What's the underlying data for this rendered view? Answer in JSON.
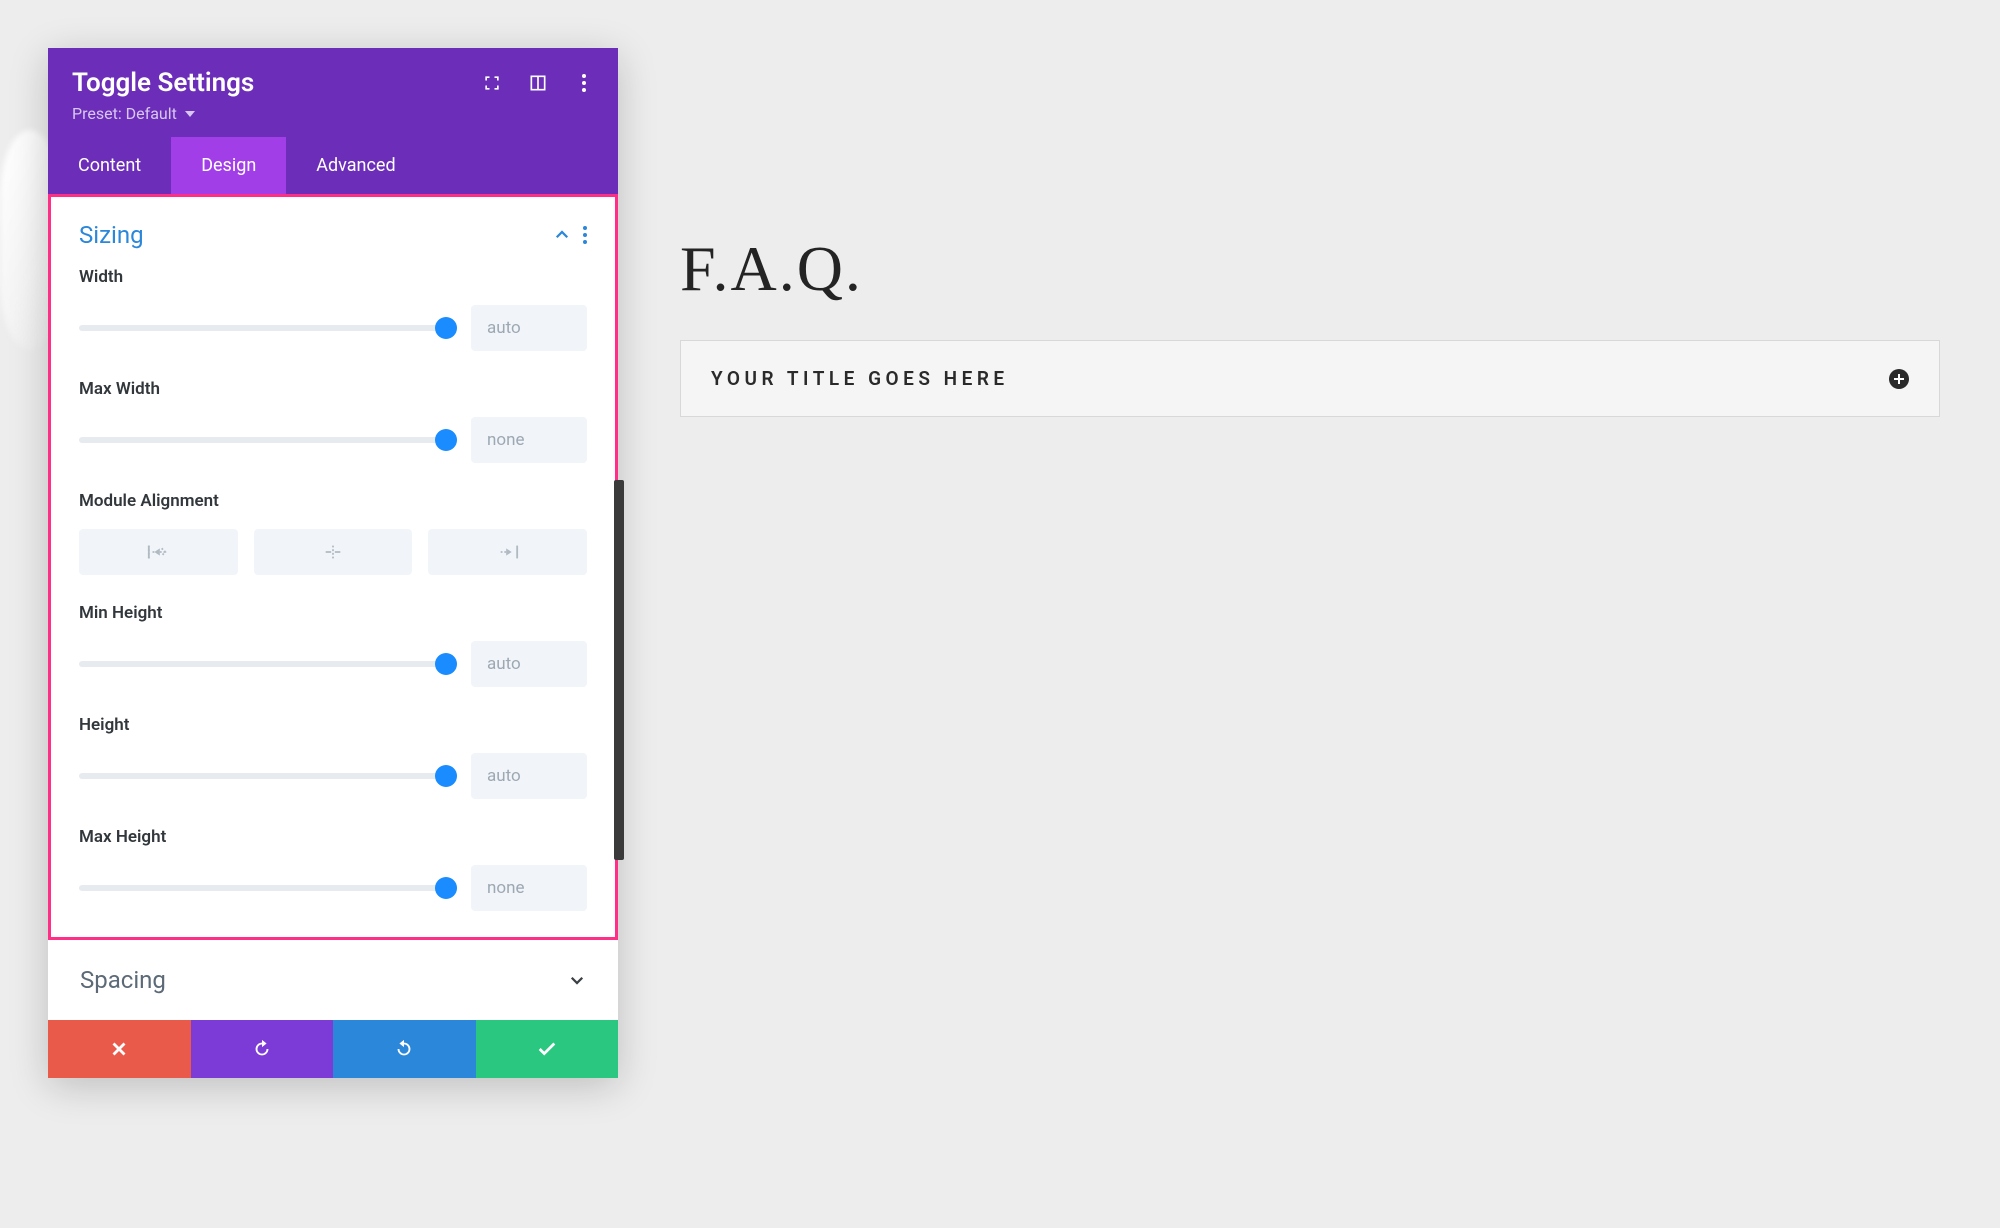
{
  "panel": {
    "title": "Toggle Settings",
    "preset_label": "Preset: Default"
  },
  "tabs": {
    "content": "Content",
    "design": "Design",
    "advanced": "Advanced"
  },
  "sections": {
    "sizing": {
      "title": "Sizing"
    },
    "spacing": {
      "title": "Spacing"
    }
  },
  "fields": {
    "width": {
      "label": "Width",
      "value": "auto"
    },
    "max_width": {
      "label": "Max Width",
      "value": "none"
    },
    "alignment": {
      "label": "Module Alignment"
    },
    "min_height": {
      "label": "Min Height",
      "value": "auto"
    },
    "height": {
      "label": "Height",
      "value": "auto"
    },
    "max_height": {
      "label": "Max Height",
      "value": "none"
    }
  },
  "preview": {
    "heading": "F.A.Q.",
    "toggle_title": "Your Title Goes Here"
  }
}
